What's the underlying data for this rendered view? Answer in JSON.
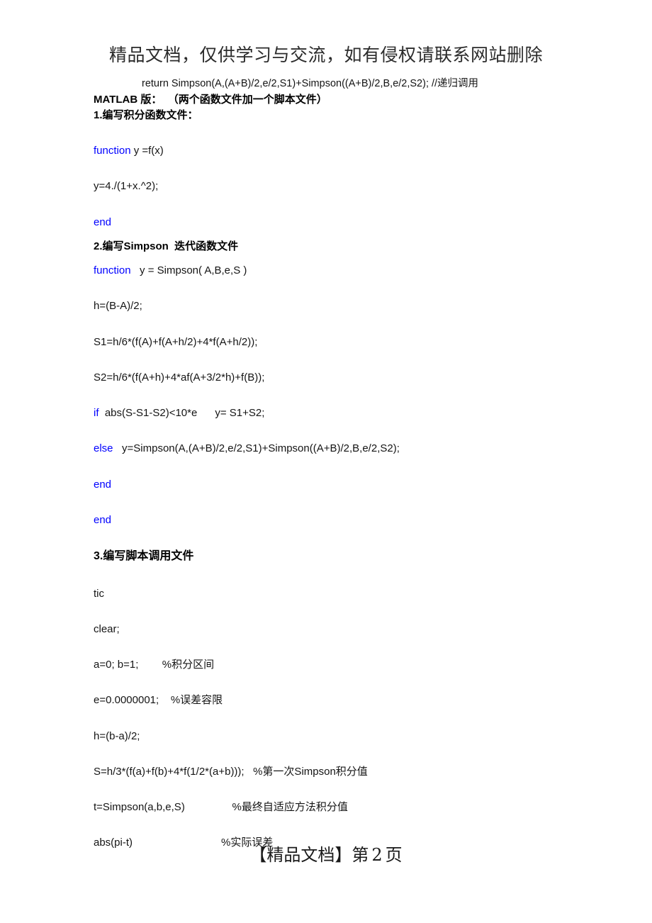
{
  "header": {
    "watermark": "精品文档，仅供学习与交流，如有侵权请联系网站删除"
  },
  "body": {
    "return_line": "return Simpson(A,(A+B)/2,e/2,S1)+Simpson((A+B)/2,B,e/2,S2); //递归调用",
    "matlab_version_line": "MATLAB 版：  （两个函数文件加一个脚本文件）",
    "section1_heading": "1.编写积分函数文件：",
    "fn1_keyword": "function",
    "fn1_signature": " y =f(x)",
    "fn1_body": "y=4./(1+x.^2);",
    "fn1_end": "end",
    "section2_heading": "2.编写Simpson  迭代函数文件",
    "fn2_keyword": "function",
    "fn2_signature": "   y = Simpson( A,B,e,S )",
    "fn2_h": "h=(B-A)/2;",
    "fn2_s1": "S1=h/6*(f(A)+f(A+h/2)+4*f(A+h/2));",
    "fn2_s2": "S2=h/6*(f(A+h)+4*af(A+3/2*h)+f(B));",
    "if_keyword": "if",
    "if_rest": "  abs(S-S1-S2)<10*e      y= S1+S2;",
    "else_keyword": "else",
    "else_rest": "   y=Simpson(A,(A+B)/2,e/2,S1)+Simpson((A+B)/2,B,e/2,S2);",
    "end_inner": "end",
    "end_outer": "end",
    "section3_heading": "3.编写脚本调用文件",
    "script_tic": "tic",
    "script_clear": "clear;",
    "script_ab": "a=0; b=1;        %积分区间",
    "script_e": "e=0.0000001;    %误差容限",
    "script_h": "h=(b-a)/2;",
    "script_S": "S=h/3*(f(a)+f(b)+4*f(1/2*(a+b)));   %第一次Simpson积分值",
    "script_t": "t=Simpson(a,b,e,S)                %最终自适应方法积分值",
    "script_abs": "abs(pi-t)                              %实际误差"
  },
  "footer": {
    "left_mark": "【精品文档】第",
    "page_number": "2",
    "page_unit": "页"
  },
  "colors": {
    "keyword_blue": "#0000ff",
    "body_text": "#141414",
    "header_text": "#2b2b2b",
    "background": "#ffffff"
  }
}
